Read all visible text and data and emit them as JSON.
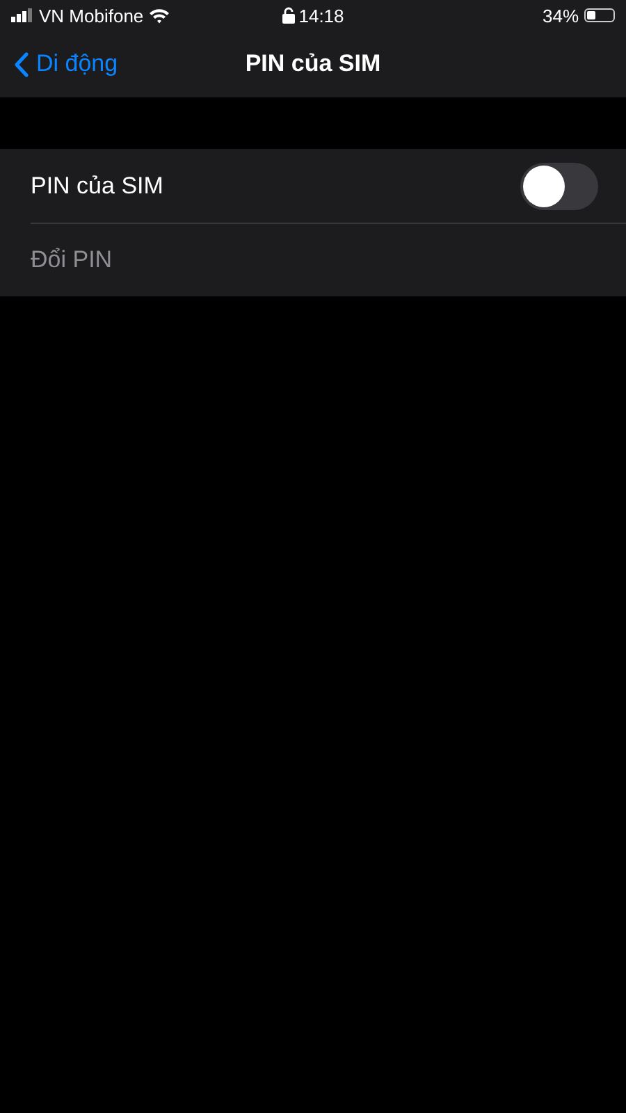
{
  "status_bar": {
    "carrier": "VN Mobifone",
    "time": "14:18",
    "battery": "34%"
  },
  "nav": {
    "back": "Di động",
    "title": "PIN của SIM"
  },
  "rows": [
    {
      "kind": "toggle",
      "label": "PIN của SIM",
      "on": false,
      "disabled": false
    },
    {
      "kind": "plain",
      "label": "Đổi PIN",
      "disabled": true
    }
  ]
}
